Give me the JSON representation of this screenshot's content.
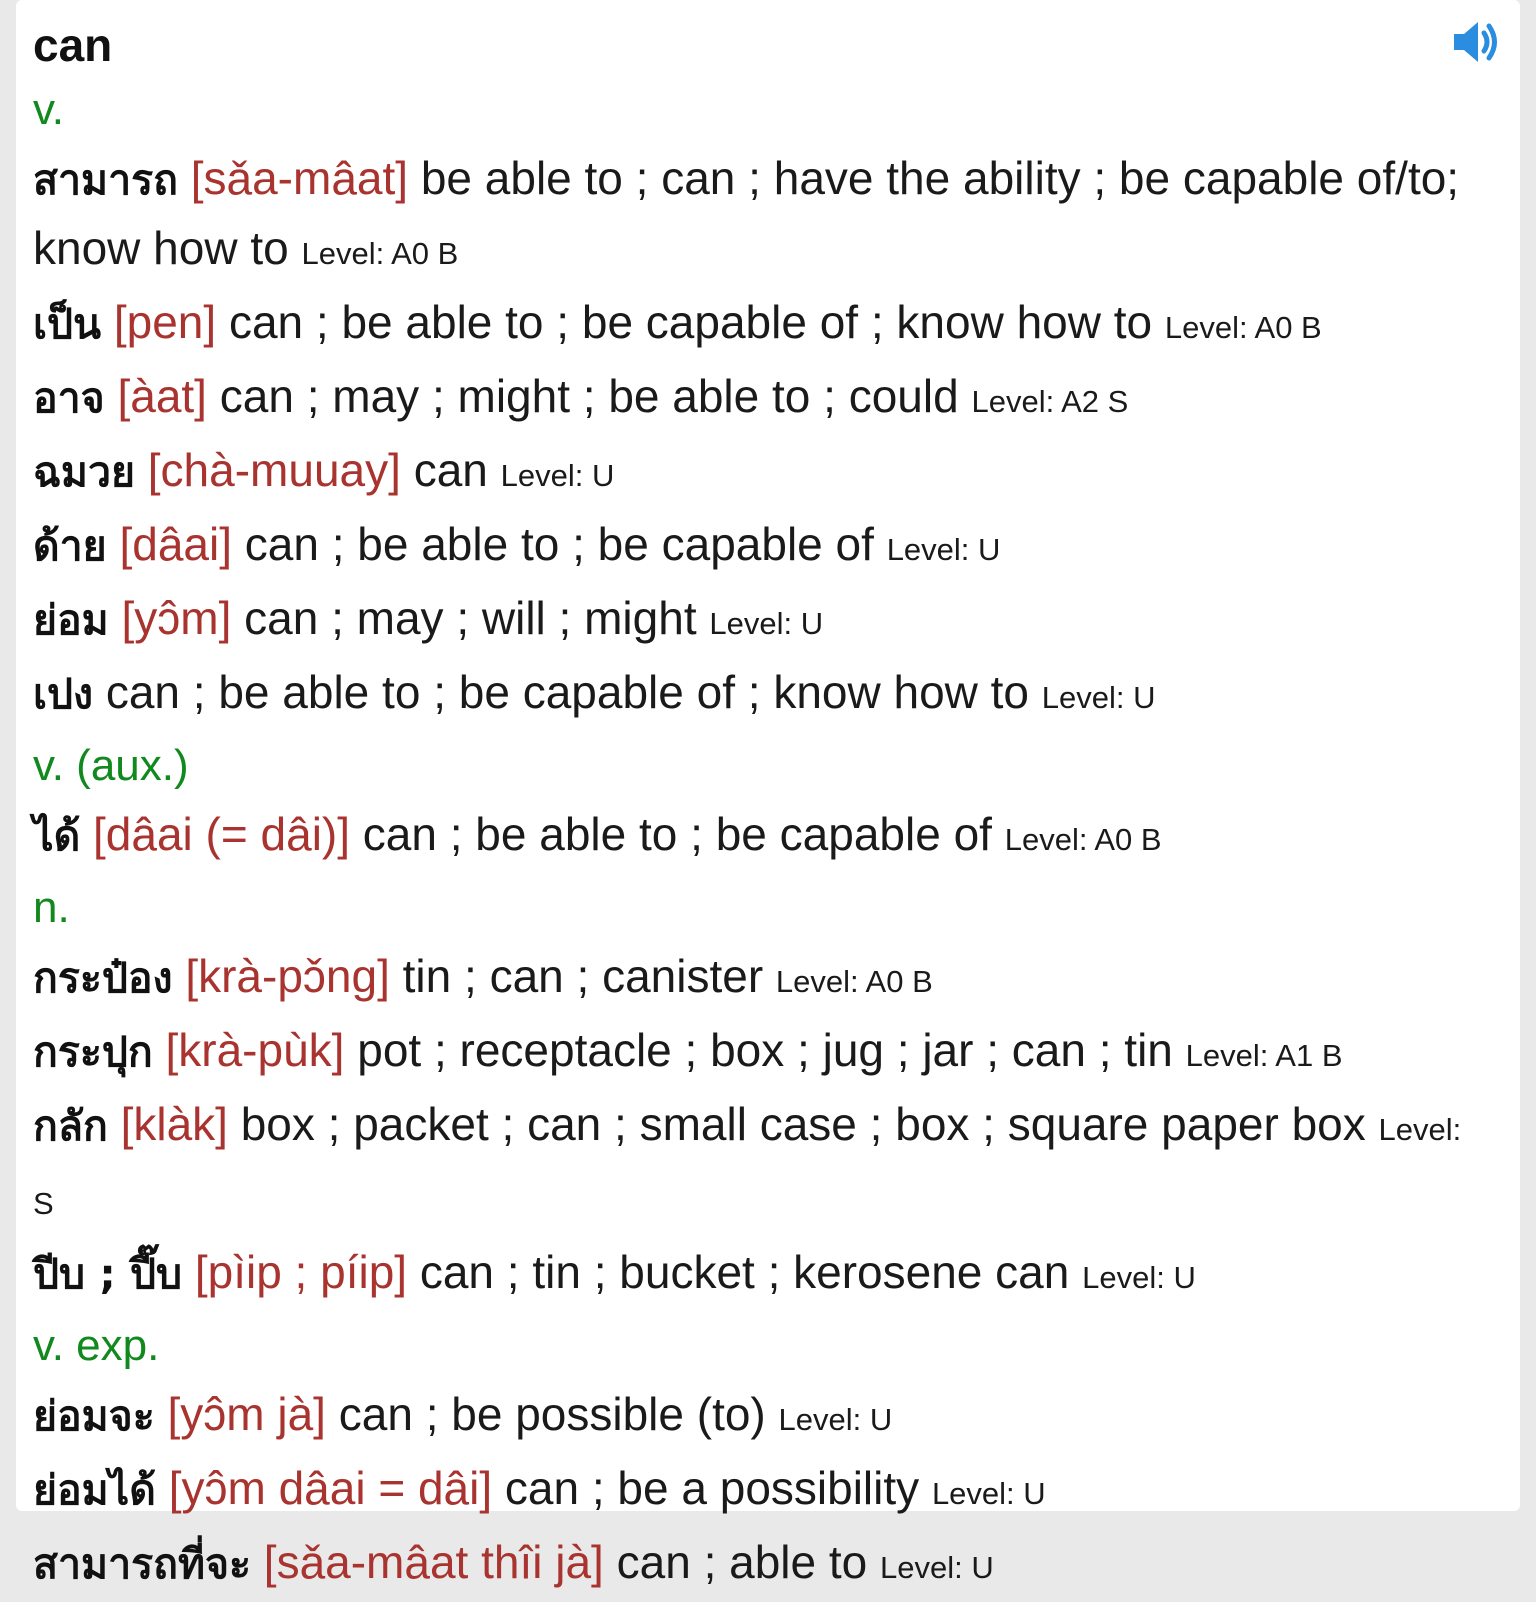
{
  "headword": "can",
  "sections": [
    {
      "pos": "v.",
      "entries": [
        {
          "thai": "สามารถ",
          "rom": "[sǎa-mâat]",
          "def": "be able to ; can ; have the ability ; be capable of/to; know how to",
          "level": "Level: A0 B"
        },
        {
          "thai": "เป็น",
          "rom": "[pen]",
          "def": "can ; be able to ; be capable of ; know how to",
          "level": "Level: A0 B"
        },
        {
          "thai": "อาจ",
          "rom": "[àat]",
          "def": "can ; may ; might ; be able to ; could",
          "level": "Level: A2 S"
        },
        {
          "thai": "ฉมวย",
          "rom": "[chà-muuay]",
          "def": "can",
          "level": "Level: U"
        },
        {
          "thai": "ด้าย",
          "rom": "[dâai]",
          "def": "can ; be able to ; be capable of",
          "level": "Level: U"
        },
        {
          "thai": "ย่อม",
          "rom": "[yɔ̂m]",
          "def": "can ; may ; will ; might",
          "level": "Level: U"
        },
        {
          "thai": "เปง",
          "rom": "",
          "def": "can ; be able to ; be capable of ; know how to",
          "level": "Level: U"
        }
      ]
    },
    {
      "pos": "v. (aux.)",
      "entries": [
        {
          "thai": "ได้",
          "rom": "[dâai (= dâi)]",
          "def": "can ; be able to ; be capable of",
          "level": "Level: A0 B"
        }
      ]
    },
    {
      "pos": "n.",
      "entries": [
        {
          "thai": "กระป๋อง",
          "rom": "[krà-pɔ̌ng]",
          "def": "tin ; can ; canister",
          "level": "Level: A0 B"
        },
        {
          "thai": "กระปุก",
          "rom": "[krà-pùk]",
          "def": "pot ; receptacle ; box ; jug ; jar ; can ; tin",
          "level": "Level: A1 B"
        },
        {
          "thai": "กลัก",
          "rom": "[klàk]",
          "def": "box ; packet ; can ; small case ; box ; square paper box",
          "level": "Level: S"
        },
        {
          "thai": "ปีบ ; ปี๊บ",
          "rom": "[pìip ; píip]",
          "def": "can ; tin ; bucket ; kerosene can",
          "level": "Level: U"
        }
      ]
    },
    {
      "pos": "v. exp.",
      "entries": [
        {
          "thai": "ย่อมจะ",
          "rom": "[yɔ̂m jà]",
          "def": "can ; be possible (to)",
          "level": "Level: U"
        },
        {
          "thai": "ย่อมได้",
          "rom": "[yɔ̂m dâai = dâi]",
          "def": "can ; be a possibility",
          "level": "Level: U"
        },
        {
          "thai": "สามารถที่จะ",
          "rom": "[sǎa-mâat thîi jà]",
          "def": "can ; able to",
          "level": "Level: U"
        }
      ]
    }
  ],
  "icons": {
    "speaker": "speaker-volume-icon"
  },
  "colors": {
    "pos": "#12891e",
    "romanization": "#a8332f",
    "speaker": "#2a8de0"
  }
}
